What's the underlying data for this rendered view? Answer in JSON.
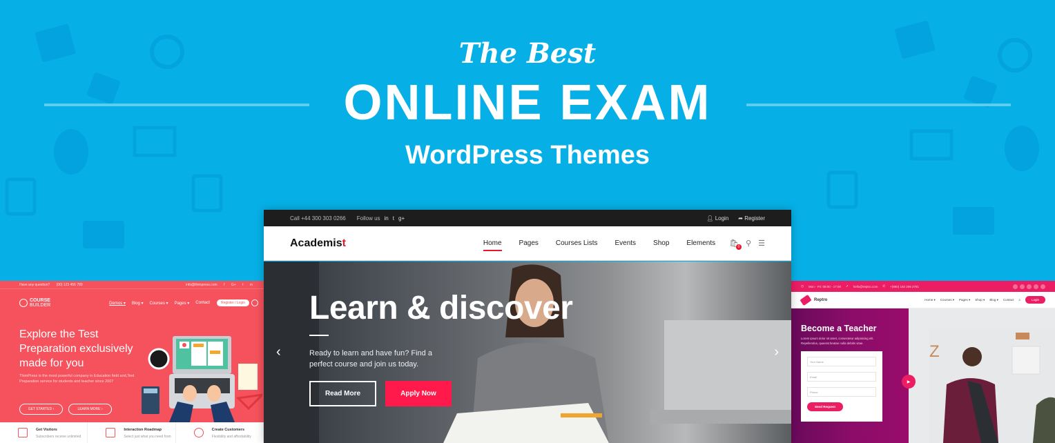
{
  "banner": {
    "line1": "The Best",
    "line2": "ONLINE EXAM",
    "line3": "WordPress Themes",
    "background_color": "#06b0e6"
  },
  "left_theme": {
    "name": "Course Builder",
    "topbar": {
      "question": "Have any question?",
      "phone": "(00) 123 456 789",
      "email": "info@thimpress.com",
      "social": [
        "f",
        "G+",
        "t",
        "m"
      ]
    },
    "logo_line1": "COURSE",
    "logo_line2": "BUILDER",
    "menu": [
      "Demos ▾",
      "Blog ▾",
      "Courses ▾",
      "Pages ▾",
      "Contact"
    ],
    "register_button": "Register / Login",
    "headline": "Explore the Test Preparation exclusively made for you",
    "description": "ThimPress is the most powerful company in Education field and,Test Preparation service for students and teacher since 2007",
    "buttons": [
      "GET STARTED ›",
      "LEARN MORE ›"
    ],
    "features": [
      {
        "title": "Get Visitors",
        "subtitle": "Subscribers receive unlimited",
        "icon": "book-icon"
      },
      {
        "title": "Interaction Roadmap",
        "subtitle": "Select just what you need from",
        "icon": "layers-icon"
      },
      {
        "title": "Create Customers",
        "subtitle": "Flexibility and affordability",
        "icon": "lightbulb-icon"
      }
    ],
    "accent": "#f5525d"
  },
  "center_theme": {
    "topbar": {
      "call": "Call +44 300 303 0266",
      "follow": "Follow us",
      "social": [
        "in",
        "t",
        "g+"
      ],
      "login": "Login",
      "register": "Register"
    },
    "logo": "Academis",
    "logo_tail": "t",
    "menu": [
      "Home",
      "Pages",
      "Courses Lists",
      "Events",
      "Shop",
      "Elements"
    ],
    "active_menu": "Home",
    "cart_count": "0",
    "hero_title": "Learn & discover",
    "hero_text": "Ready to learn and have fun? Find a perfect course and join us today.",
    "read_more": "Read More",
    "apply_now": "Apply Now",
    "accent": "#ff1a4b"
  },
  "right_theme": {
    "topbar": {
      "hours": "Mon - Fri: 08:00 - 17:00",
      "email": "hello@reptro.com",
      "phone": "+(880) 182 206 2781"
    },
    "logo": "Reptro",
    "menu": [
      "Home ▾",
      "Courses ▾",
      "Pages ▾",
      "Shop ▾",
      "Blog ▾",
      "Contact",
      "≡"
    ],
    "login": "Login",
    "headline": "Become a Teacher",
    "description": "Lorem ipsum dolor sit amet, consectetur adipisicing elit. Repellendus, quaerat beatae nulla debitis vitae.",
    "form": {
      "name_placeholder": "Your Name",
      "email_placeholder": "Email",
      "phone_placeholder": "Phone",
      "submit": "Send Request"
    },
    "accent": "#ec1e63"
  }
}
